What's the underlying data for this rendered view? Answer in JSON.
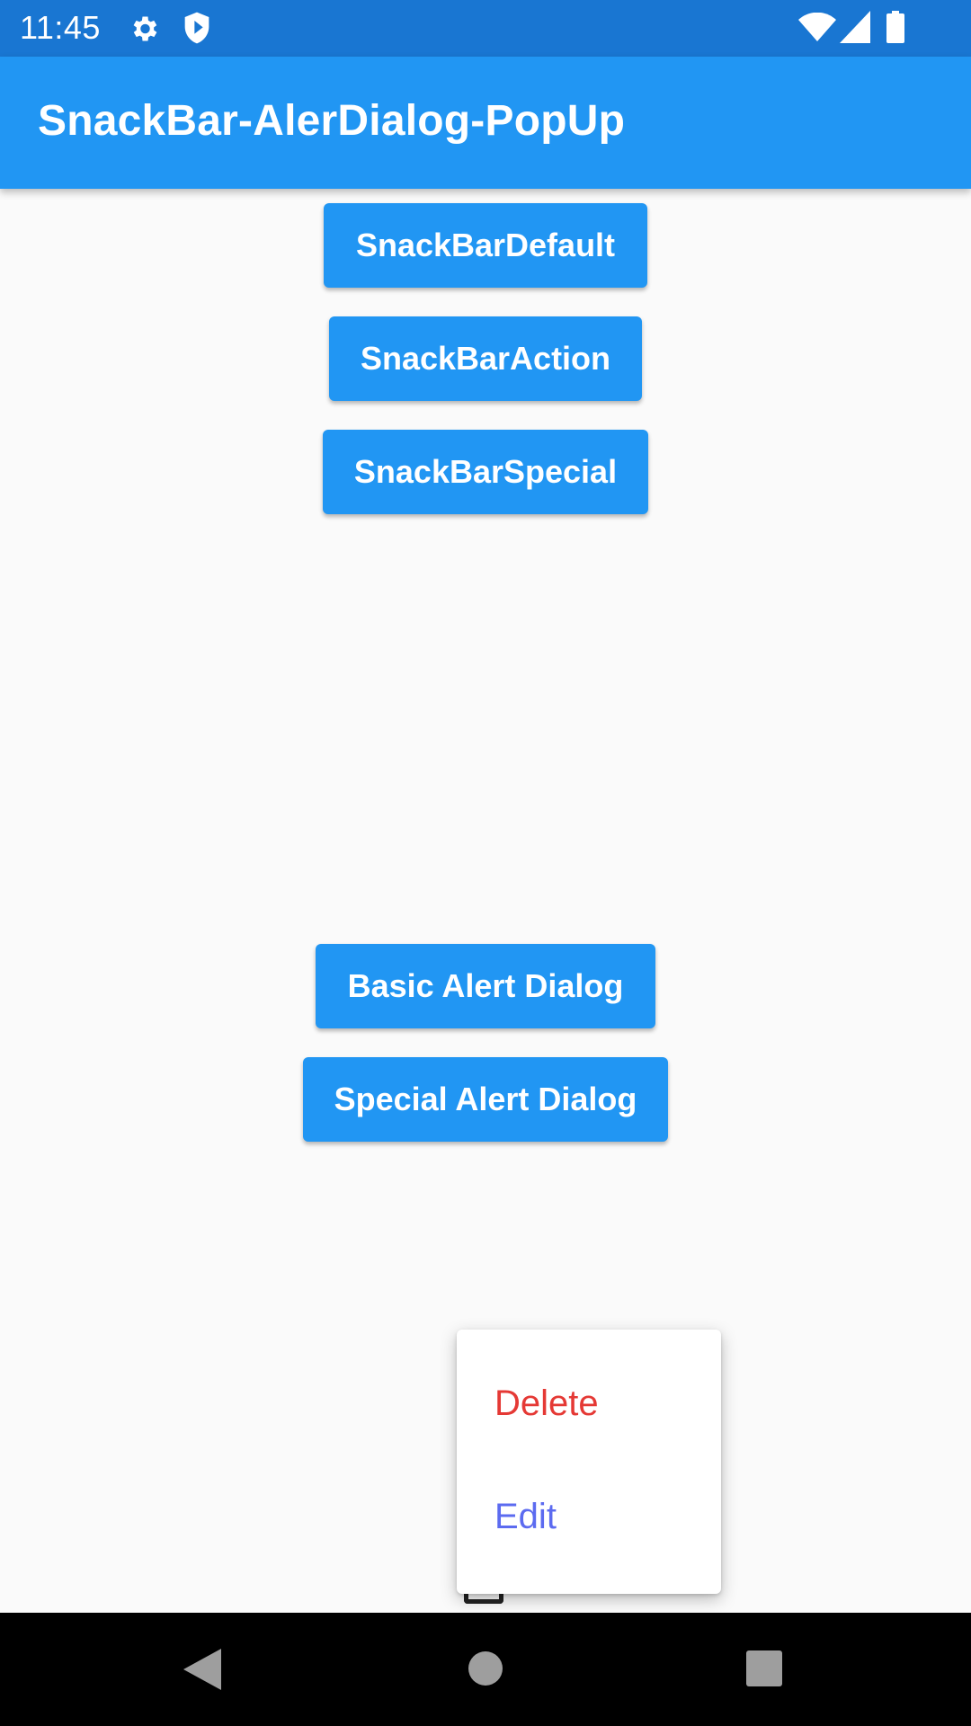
{
  "status_bar": {
    "time": "11:45",
    "icons": [
      "gear-icon",
      "shield-icon",
      "wifi-icon",
      "signal-icon",
      "battery-icon"
    ]
  },
  "app_bar": {
    "title": "SnackBar-AlerDialog-PopUp",
    "color": "#2196f3"
  },
  "buttons": {
    "snackbar_default": "SnackBarDefault",
    "snackbar_action": "SnackBarAction",
    "snackbar_special": "SnackBarSpecial",
    "basic_alert": "Basic Alert Dialog",
    "special_alert": "Special Alert Dialog"
  },
  "popup_menu": {
    "items": [
      {
        "label": "Delete",
        "color": "#e53935"
      },
      {
        "label": "Edit",
        "color": "#5c6bf0"
      }
    ]
  },
  "nav_bar": {
    "icons": [
      "back-icon",
      "home-icon",
      "recents-icon"
    ]
  }
}
